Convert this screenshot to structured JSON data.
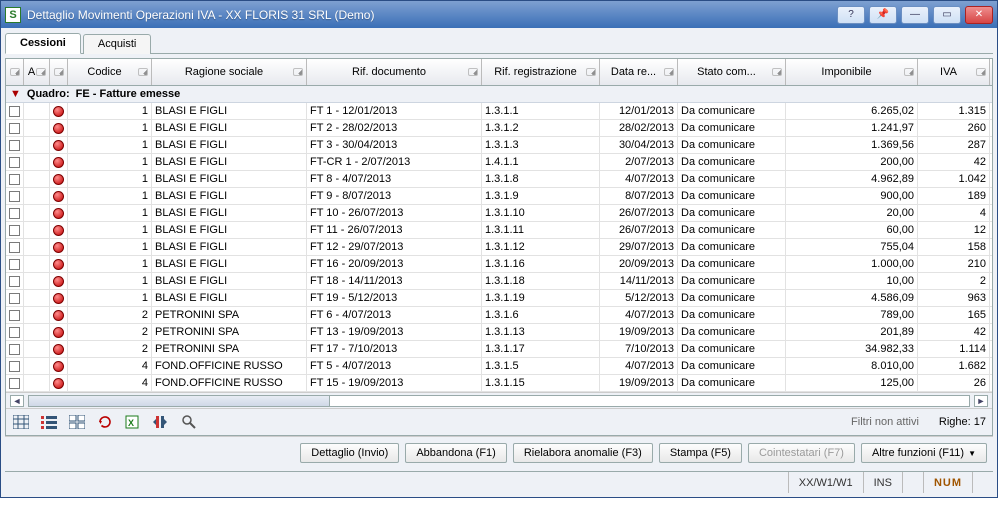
{
  "window": {
    "app_glyph": "S",
    "title": "Dettaglio Movimenti Operazioni IVA - XX FLORIS 31 SRL  (Demo)"
  },
  "tabs": [
    {
      "label": "Cessioni",
      "active": true
    },
    {
      "label": "Acquisti",
      "active": false
    }
  ],
  "columns": {
    "a": "A",
    "codice": "Codice",
    "ragione": "Ragione sociale",
    "rifdoc": "Rif. documento",
    "rifreg": "Rif. registrazione",
    "datare": "Data re...",
    "stato": "Stato com...",
    "imponibile": "Imponibile",
    "iva": "IVA"
  },
  "group": {
    "prefix": "Quadro:",
    "label": "FE - Fatture emesse"
  },
  "rows": [
    {
      "codice": "1",
      "ragione": "BLASI E FIGLI",
      "rifdoc": "FT 1 - 12/01/2013",
      "rifreg": "1.3.1.1",
      "data": "12/01/2013",
      "stato": "Da comunicare",
      "imponibile": "6.265,02",
      "iva": "1.315"
    },
    {
      "codice": "1",
      "ragione": "BLASI E FIGLI",
      "rifdoc": "FT 2 - 28/02/2013",
      "rifreg": "1.3.1.2",
      "data": "28/02/2013",
      "stato": "Da comunicare",
      "imponibile": "1.241,97",
      "iva": "260"
    },
    {
      "codice": "1",
      "ragione": "BLASI E FIGLI",
      "rifdoc": "FT 3 - 30/04/2013",
      "rifreg": "1.3.1.3",
      "data": "30/04/2013",
      "stato": "Da comunicare",
      "imponibile": "1.369,56",
      "iva": "287"
    },
    {
      "codice": "1",
      "ragione": "BLASI E FIGLI",
      "rifdoc": "FT-CR 1 - 2/07/2013",
      "rifreg": "1.4.1.1",
      "data": "2/07/2013",
      "stato": "Da comunicare",
      "imponibile": "200,00",
      "iva": "42"
    },
    {
      "codice": "1",
      "ragione": "BLASI E FIGLI",
      "rifdoc": "FT 8 - 4/07/2013",
      "rifreg": "1.3.1.8",
      "data": "4/07/2013",
      "stato": "Da comunicare",
      "imponibile": "4.962,89",
      "iva": "1.042"
    },
    {
      "codice": "1",
      "ragione": "BLASI E FIGLI",
      "rifdoc": "FT 9 - 8/07/2013",
      "rifreg": "1.3.1.9",
      "data": "8/07/2013",
      "stato": "Da comunicare",
      "imponibile": "900,00",
      "iva": "189"
    },
    {
      "codice": "1",
      "ragione": "BLASI E FIGLI",
      "rifdoc": "FT 10 - 26/07/2013",
      "rifreg": "1.3.1.10",
      "data": "26/07/2013",
      "stato": "Da comunicare",
      "imponibile": "20,00",
      "iva": "4"
    },
    {
      "codice": "1",
      "ragione": "BLASI E FIGLI",
      "rifdoc": "FT 11 - 26/07/2013",
      "rifreg": "1.3.1.11",
      "data": "26/07/2013",
      "stato": "Da comunicare",
      "imponibile": "60,00",
      "iva": "12"
    },
    {
      "codice": "1",
      "ragione": "BLASI E FIGLI",
      "rifdoc": "FT 12 - 29/07/2013",
      "rifreg": "1.3.1.12",
      "data": "29/07/2013",
      "stato": "Da comunicare",
      "imponibile": "755,04",
      "iva": "158"
    },
    {
      "codice": "1",
      "ragione": "BLASI E FIGLI",
      "rifdoc": "FT 16 - 20/09/2013",
      "rifreg": "1.3.1.16",
      "data": "20/09/2013",
      "stato": "Da comunicare",
      "imponibile": "1.000,00",
      "iva": "210"
    },
    {
      "codice": "1",
      "ragione": "BLASI E FIGLI",
      "rifdoc": "FT 18 - 14/11/2013",
      "rifreg": "1.3.1.18",
      "data": "14/11/2013",
      "stato": "Da comunicare",
      "imponibile": "10,00",
      "iva": "2"
    },
    {
      "codice": "1",
      "ragione": "BLASI E FIGLI",
      "rifdoc": "FT 19 - 5/12/2013",
      "rifreg": "1.3.1.19",
      "data": "5/12/2013",
      "stato": "Da comunicare",
      "imponibile": "4.586,09",
      "iva": "963"
    },
    {
      "codice": "2",
      "ragione": "PETRONINI SPA",
      "rifdoc": "FT 6 - 4/07/2013",
      "rifreg": "1.3.1.6",
      "data": "4/07/2013",
      "stato": "Da comunicare",
      "imponibile": "789,00",
      "iva": "165"
    },
    {
      "codice": "2",
      "ragione": "PETRONINI SPA",
      "rifdoc": "FT 13 - 19/09/2013",
      "rifreg": "1.3.1.13",
      "data": "19/09/2013",
      "stato": "Da comunicare",
      "imponibile": "201,89",
      "iva": "42"
    },
    {
      "codice": "2",
      "ragione": "PETRONINI SPA",
      "rifdoc": "FT 17 - 7/10/2013",
      "rifreg": "1.3.1.17",
      "data": "7/10/2013",
      "stato": "Da comunicare",
      "imponibile": "34.982,33",
      "iva": "1.114"
    },
    {
      "codice": "4",
      "ragione": "FOND.OFFICINE RUSSO",
      "rifdoc": "FT 5 - 4/07/2013",
      "rifreg": "1.3.1.5",
      "data": "4/07/2013",
      "stato": "Da comunicare",
      "imponibile": "8.010,00",
      "iva": "1.682"
    },
    {
      "codice": "4",
      "ragione": "FOND.OFFICINE RUSSO",
      "rifdoc": "FT 15 - 19/09/2013",
      "rifreg": "1.3.1.15",
      "data": "19/09/2013",
      "stato": "Da comunicare",
      "imponibile": "125,00",
      "iva": "26"
    }
  ],
  "footer": {
    "filter_label": "Filtri non attivi",
    "rows_label": "Righe: 17"
  },
  "actions": {
    "dettaglio": "Dettaglio (Invio)",
    "abbandona": "Abbandona (F1)",
    "rielabora": "Rielabora anomalie (F3)",
    "stampa": "Stampa (F5)",
    "cointestatari": "Cointestatari (F7)",
    "altre": "Altre funzioni (F11)"
  },
  "statusbar": {
    "path": "XX/W1/W1",
    "ins": "INS",
    "num": "NUM"
  }
}
